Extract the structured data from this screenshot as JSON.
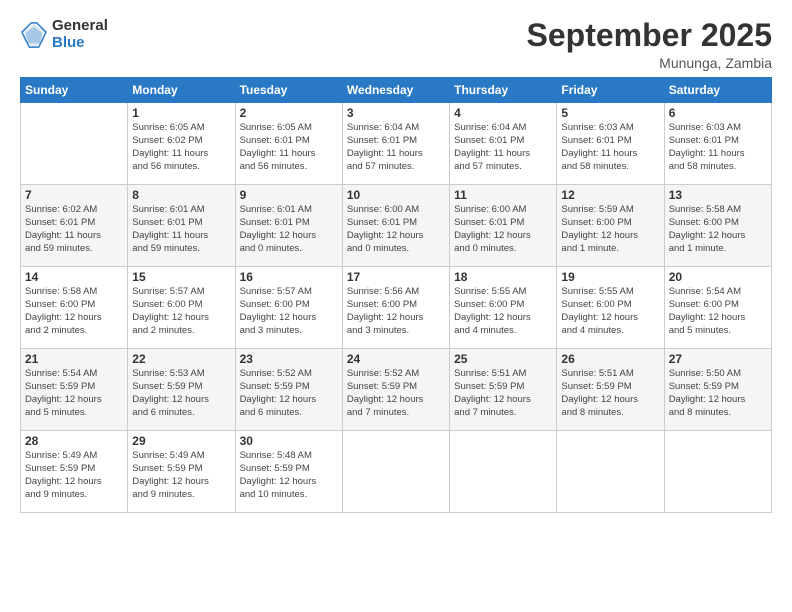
{
  "logo": {
    "general": "General",
    "blue": "Blue"
  },
  "header": {
    "title": "September 2025",
    "subtitle": "Mununga, Zambia"
  },
  "weekdays": [
    "Sunday",
    "Monday",
    "Tuesday",
    "Wednesday",
    "Thursday",
    "Friday",
    "Saturday"
  ],
  "weeks": [
    [
      {
        "day": "",
        "info": ""
      },
      {
        "day": "1",
        "info": "Sunrise: 6:05 AM\nSunset: 6:02 PM\nDaylight: 11 hours\nand 56 minutes."
      },
      {
        "day": "2",
        "info": "Sunrise: 6:05 AM\nSunset: 6:01 PM\nDaylight: 11 hours\nand 56 minutes."
      },
      {
        "day": "3",
        "info": "Sunrise: 6:04 AM\nSunset: 6:01 PM\nDaylight: 11 hours\nand 57 minutes."
      },
      {
        "day": "4",
        "info": "Sunrise: 6:04 AM\nSunset: 6:01 PM\nDaylight: 11 hours\nand 57 minutes."
      },
      {
        "day": "5",
        "info": "Sunrise: 6:03 AM\nSunset: 6:01 PM\nDaylight: 11 hours\nand 58 minutes."
      },
      {
        "day": "6",
        "info": "Sunrise: 6:03 AM\nSunset: 6:01 PM\nDaylight: 11 hours\nand 58 minutes."
      }
    ],
    [
      {
        "day": "7",
        "info": "Sunrise: 6:02 AM\nSunset: 6:01 PM\nDaylight: 11 hours\nand 59 minutes."
      },
      {
        "day": "8",
        "info": "Sunrise: 6:01 AM\nSunset: 6:01 PM\nDaylight: 11 hours\nand 59 minutes."
      },
      {
        "day": "9",
        "info": "Sunrise: 6:01 AM\nSunset: 6:01 PM\nDaylight: 12 hours\nand 0 minutes."
      },
      {
        "day": "10",
        "info": "Sunrise: 6:00 AM\nSunset: 6:01 PM\nDaylight: 12 hours\nand 0 minutes."
      },
      {
        "day": "11",
        "info": "Sunrise: 6:00 AM\nSunset: 6:01 PM\nDaylight: 12 hours\nand 0 minutes."
      },
      {
        "day": "12",
        "info": "Sunrise: 5:59 AM\nSunset: 6:00 PM\nDaylight: 12 hours\nand 1 minute."
      },
      {
        "day": "13",
        "info": "Sunrise: 5:58 AM\nSunset: 6:00 PM\nDaylight: 12 hours\nand 1 minute."
      }
    ],
    [
      {
        "day": "14",
        "info": "Sunrise: 5:58 AM\nSunset: 6:00 PM\nDaylight: 12 hours\nand 2 minutes."
      },
      {
        "day": "15",
        "info": "Sunrise: 5:57 AM\nSunset: 6:00 PM\nDaylight: 12 hours\nand 2 minutes."
      },
      {
        "day": "16",
        "info": "Sunrise: 5:57 AM\nSunset: 6:00 PM\nDaylight: 12 hours\nand 3 minutes."
      },
      {
        "day": "17",
        "info": "Sunrise: 5:56 AM\nSunset: 6:00 PM\nDaylight: 12 hours\nand 3 minutes."
      },
      {
        "day": "18",
        "info": "Sunrise: 5:55 AM\nSunset: 6:00 PM\nDaylight: 12 hours\nand 4 minutes."
      },
      {
        "day": "19",
        "info": "Sunrise: 5:55 AM\nSunset: 6:00 PM\nDaylight: 12 hours\nand 4 minutes."
      },
      {
        "day": "20",
        "info": "Sunrise: 5:54 AM\nSunset: 6:00 PM\nDaylight: 12 hours\nand 5 minutes."
      }
    ],
    [
      {
        "day": "21",
        "info": "Sunrise: 5:54 AM\nSunset: 5:59 PM\nDaylight: 12 hours\nand 5 minutes."
      },
      {
        "day": "22",
        "info": "Sunrise: 5:53 AM\nSunset: 5:59 PM\nDaylight: 12 hours\nand 6 minutes."
      },
      {
        "day": "23",
        "info": "Sunrise: 5:52 AM\nSunset: 5:59 PM\nDaylight: 12 hours\nand 6 minutes."
      },
      {
        "day": "24",
        "info": "Sunrise: 5:52 AM\nSunset: 5:59 PM\nDaylight: 12 hours\nand 7 minutes."
      },
      {
        "day": "25",
        "info": "Sunrise: 5:51 AM\nSunset: 5:59 PM\nDaylight: 12 hours\nand 7 minutes."
      },
      {
        "day": "26",
        "info": "Sunrise: 5:51 AM\nSunset: 5:59 PM\nDaylight: 12 hours\nand 8 minutes."
      },
      {
        "day": "27",
        "info": "Sunrise: 5:50 AM\nSunset: 5:59 PM\nDaylight: 12 hours\nand 8 minutes."
      }
    ],
    [
      {
        "day": "28",
        "info": "Sunrise: 5:49 AM\nSunset: 5:59 PM\nDaylight: 12 hours\nand 9 minutes."
      },
      {
        "day": "29",
        "info": "Sunrise: 5:49 AM\nSunset: 5:59 PM\nDaylight: 12 hours\nand 9 minutes."
      },
      {
        "day": "30",
        "info": "Sunrise: 5:48 AM\nSunset: 5:59 PM\nDaylight: 12 hours\nand 10 minutes."
      },
      {
        "day": "",
        "info": ""
      },
      {
        "day": "",
        "info": ""
      },
      {
        "day": "",
        "info": ""
      },
      {
        "day": "",
        "info": ""
      }
    ]
  ]
}
